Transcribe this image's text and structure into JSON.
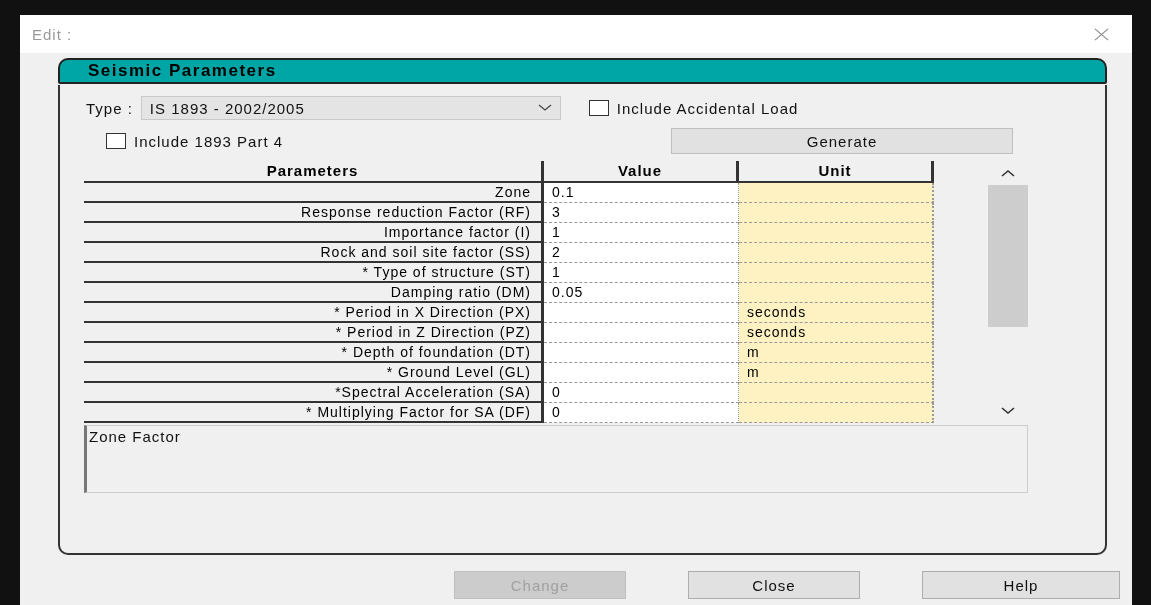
{
  "window": {
    "title": "Edit :"
  },
  "section_title": "Seismic Parameters",
  "type_field": {
    "label": "Type :",
    "value": "IS 1893 - 2002/2005"
  },
  "options": [
    {
      "label": "Include Accidental Load",
      "checked": false
    },
    {
      "label": "Include 1893 Part 4",
      "checked": false
    }
  ],
  "generate_button": "Generate",
  "table": {
    "columns": [
      "Parameters",
      "Value",
      "Unit"
    ],
    "rows": [
      {
        "parameter": "Zone",
        "value": "0.1",
        "unit": ""
      },
      {
        "parameter": "Response reduction Factor (RF)",
        "value": "3",
        "unit": ""
      },
      {
        "parameter": "Importance factor (I)",
        "value": "1",
        "unit": ""
      },
      {
        "parameter": "Rock and soil site factor (SS)",
        "value": "2",
        "unit": ""
      },
      {
        "parameter": "* Type of structure (ST)",
        "value": "1",
        "unit": ""
      },
      {
        "parameter": "Damping ratio (DM)",
        "value": "0.05",
        "unit": ""
      },
      {
        "parameter": "* Period in X Direction (PX)",
        "value": "",
        "unit": "seconds"
      },
      {
        "parameter": "* Period in Z Direction (PZ)",
        "value": "",
        "unit": "seconds"
      },
      {
        "parameter": "* Depth of foundation (DT)",
        "value": "",
        "unit": "m"
      },
      {
        "parameter": "* Ground Level (GL)",
        "value": "",
        "unit": "m"
      },
      {
        "parameter": "*Spectral Acceleration (SA)",
        "value": "0",
        "unit": ""
      },
      {
        "parameter": "* Multiplying Factor for SA (DF)",
        "value": "0",
        "unit": ""
      }
    ]
  },
  "description": "Zone Factor",
  "buttons": [
    {
      "label": "Change",
      "disabled": true
    },
    {
      "label": "Close",
      "disabled": false
    },
    {
      "label": "Help",
      "disabled": false
    }
  ]
}
